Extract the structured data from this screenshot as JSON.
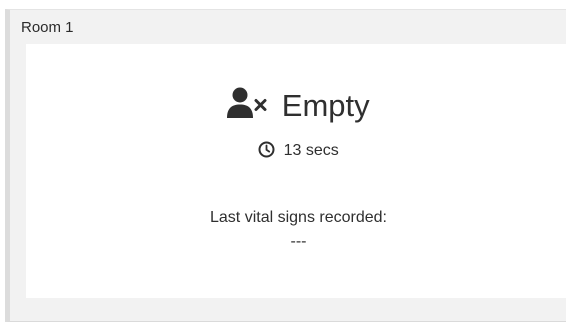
{
  "room": {
    "title": "Room 1",
    "status_icon": "user-x-icon",
    "status": "Empty",
    "timer_icon": "clock-icon",
    "elapsed": "13 secs",
    "vitals_label": "Last vital signs recorded:",
    "vitals_value": "---"
  },
  "colors": {
    "card_background": "#f2f2f2",
    "body_background": "#ffffff",
    "text": "#2f2f2f",
    "border": "#dcdcdc"
  }
}
